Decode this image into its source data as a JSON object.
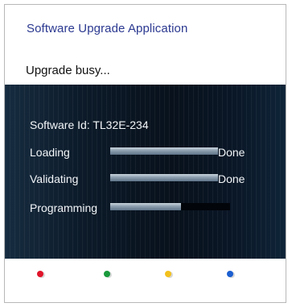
{
  "app": {
    "title": "Software Upgrade Application",
    "status": "Upgrade busy..."
  },
  "software": {
    "id_text": "Software Id: TL32E-234"
  },
  "steps": [
    {
      "label": "Loading",
      "progress": 1.0,
      "result": "Done"
    },
    {
      "label": "Validating",
      "progress": 1.0,
      "result": "Done"
    },
    {
      "label": "Programming",
      "progress": 0.59,
      "result": ""
    }
  ],
  "color_keys": [
    {
      "name": "red",
      "color": "#e0142a"
    },
    {
      "name": "green",
      "color": "#1a9a3c"
    },
    {
      "name": "yellow",
      "color": "#f3c11d"
    },
    {
      "name": "blue",
      "color": "#1c5fd0"
    }
  ]
}
